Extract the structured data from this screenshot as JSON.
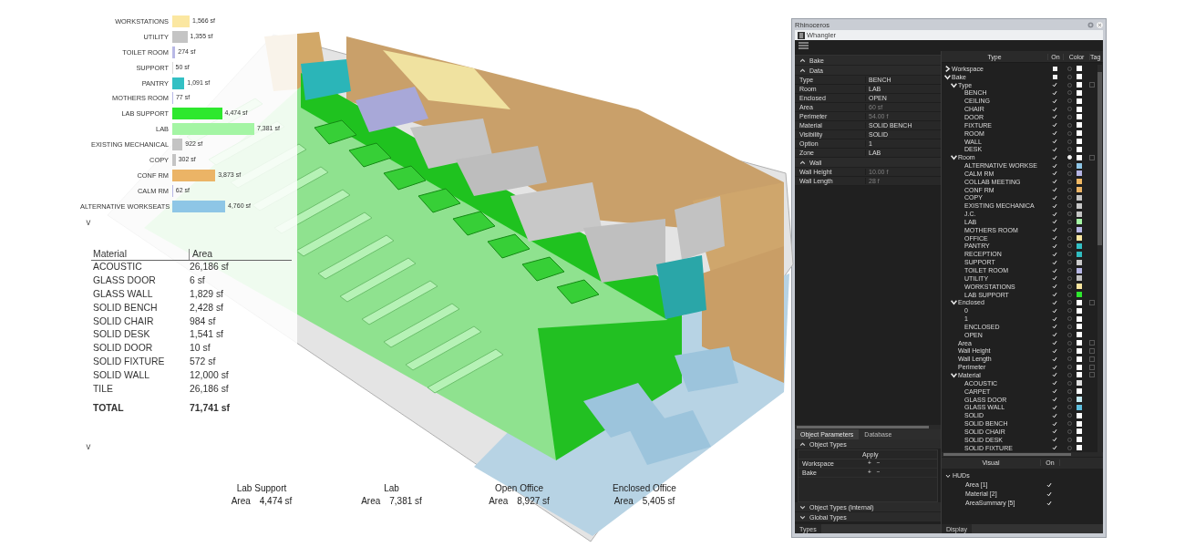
{
  "viewport": {
    "area_legend": [
      {
        "label": "WORKSTATIONS",
        "value": "1,566 sf",
        "color": "#fbe7a1"
      },
      {
        "label": "UTILITY",
        "value": "1,355 sf",
        "color": "#c4c4c4"
      },
      {
        "label": "TOILET ROOM",
        "value": "274 sf",
        "color": "#b8b8e6"
      },
      {
        "label": "SUPPORT",
        "value": "50 sf",
        "color": "#d8d8d8"
      },
      {
        "label": "PANTRY",
        "value": "1,091 sf",
        "color": "#33c0c4"
      },
      {
        "label": "MOTHERS ROOM",
        "value": "77 sf",
        "color": "#b8b8e6"
      },
      {
        "label": "LAB SUPPORT",
        "value": "4,474 sf",
        "color": "#2ee82e"
      },
      {
        "label": "LAB",
        "value": "7,381 sf",
        "color": "#a4f5a4"
      },
      {
        "label": "EXISTING MECHANICAL",
        "value": "922 sf",
        "color": "#c4c4c4"
      },
      {
        "label": "COPY",
        "value": "302 sf",
        "color": "#c4c4c4"
      },
      {
        "label": "CONF RM",
        "value": "3,873 sf",
        "color": "#ebb466"
      },
      {
        "label": "CALM RM",
        "value": "62 sf",
        "color": "#b8b8e6"
      },
      {
        "label": "ALTERNATIVE WORKSEATS",
        "value": "4,760 sf",
        "color": "#8ec6e6"
      }
    ],
    "legend_toggle": "˅",
    "material_table": {
      "columns": [
        "Material",
        "Area"
      ],
      "rows": [
        [
          "ACOUSTIC",
          "26,186 sf"
        ],
        [
          "GLASS DOOR",
          "6 sf"
        ],
        [
          "GLASS WALL",
          "1,829 sf"
        ],
        [
          "SOLID BENCH",
          "2,428 sf"
        ],
        [
          "SOLID CHAIR",
          "984 sf"
        ],
        [
          "SOLID DESK",
          "1,541 sf"
        ],
        [
          "SOLID DOOR",
          "10 sf"
        ],
        [
          "SOLID FIXTURE",
          "572 sf"
        ],
        [
          "SOLID WALL",
          "12,000 sf"
        ],
        [
          "TILE",
          "26,186 sf"
        ]
      ],
      "total": [
        "TOTAL",
        "71,741 sf"
      ]
    },
    "summary_toggle": "˅",
    "zone_summaries": [
      {
        "name": "Lab Support",
        "label": "Area",
        "value": "4,474 sf"
      },
      {
        "name": "Lab",
        "label": "Area",
        "value": "7,381 sf"
      },
      {
        "name": "Open Office",
        "label": "Area",
        "value": "8,927 sf"
      },
      {
        "name": "Enclosed Office",
        "label": "Area",
        "value": "5,405 sf"
      }
    ]
  },
  "window": {
    "title": "Rhinoceros",
    "panel_tab": "Whangler",
    "properties": {
      "title": "Bake",
      "expanded": true,
      "groups": [
        {
          "title": "Data",
          "expanded": true,
          "rows": [
            {
              "name": "Type",
              "value": "BENCH",
              "disabled": false
            },
            {
              "name": "Room",
              "value": "LAB",
              "disabled": false
            },
            {
              "name": "Enclosed",
              "value": "OPEN",
              "disabled": false
            },
            {
              "name": "Area",
              "value": "60 sf",
              "disabled": true
            },
            {
              "name": "Perimeter",
              "value": "54.00 f",
              "disabled": true
            },
            {
              "name": "Material",
              "value": "SOLID BENCH",
              "disabled": false
            },
            {
              "name": "Visibility",
              "value": "SOLID",
              "disabled": false
            },
            {
              "name": "Option",
              "value": "1",
              "disabled": false
            },
            {
              "name": "Zone",
              "value": "LAB",
              "disabled": false
            }
          ]
        },
        {
          "title": "Wall",
          "expanded": true,
          "rows": [
            {
              "name": "Wall Height",
              "value": "10.00 f",
              "disabled": true
            },
            {
              "name": "Wall Length",
              "value": "28 f",
              "disabled": true
            }
          ]
        }
      ]
    },
    "bottom_tabs": [
      {
        "label": "Object Parameters",
        "selected": true
      },
      {
        "label": "Database",
        "selected": false
      }
    ],
    "object_types": {
      "title": "Object Types",
      "expanded": true,
      "column": "Apply",
      "rows": [
        {
          "name": "Workspace",
          "add": "+",
          "remove": "−"
        },
        {
          "name": "Bake",
          "add": "+",
          "remove": "−"
        }
      ]
    },
    "collapsed_sections": [
      {
        "title": "Object Types (Internal)",
        "expanded": false
      },
      {
        "title": "Global Types",
        "expanded": false
      }
    ],
    "left_footer_tab": "Types",
    "type_tree": {
      "columns": [
        "Type",
        "On",
        "Color",
        "Tag"
      ],
      "items": [
        {
          "label": "Workspace",
          "expanded": false,
          "on": false,
          "partial": true,
          "radio": false,
          "color": "#ffffff"
        },
        {
          "label": "Bake",
          "expanded": true,
          "on": false,
          "partial": true,
          "radio": false,
          "color": "#ffffff",
          "children": [
            {
              "label": "Type",
              "expanded": true,
              "on": true,
              "partial": false,
              "radio": false,
              "color": "#ffffff",
              "tag": false,
              "children": [
                {
                  "label": "BENCH",
                  "on": true,
                  "partial": false,
                  "radio": false,
                  "color": "#ffffff"
                },
                {
                  "label": "CEILING",
                  "on": true,
                  "partial": false,
                  "radio": false,
                  "color": "#ffffff"
                },
                {
                  "label": "CHAIR",
                  "on": true,
                  "partial": false,
                  "radio": false,
                  "color": "#ffffff"
                },
                {
                  "label": "DOOR",
                  "on": true,
                  "partial": false,
                  "radio": false,
                  "color": "#ffffff"
                },
                {
                  "label": "FIXTURE",
                  "on": true,
                  "partial": false,
                  "radio": false,
                  "color": "#ffffff"
                },
                {
                  "label": "ROOM",
                  "on": true,
                  "partial": false,
                  "radio": false,
                  "color": "#ffffff"
                },
                {
                  "label": "WALL",
                  "on": true,
                  "partial": false,
                  "radio": false,
                  "color": "#ffffff"
                },
                {
                  "label": "DESK",
                  "on": true,
                  "partial": false,
                  "radio": false,
                  "color": "#ffffff"
                }
              ]
            },
            {
              "label": "Room",
              "expanded": true,
              "on": true,
              "partial": false,
              "radio": true,
              "color": "#ffffff",
              "tag": false,
              "children": [
                {
                  "label": "ALTERNATIVE WORKSE",
                  "on": true,
                  "partial": false,
                  "radio": false,
                  "color": "#8ec6e6"
                },
                {
                  "label": "CALM RM",
                  "on": true,
                  "partial": false,
                  "radio": false,
                  "color": "#b4b4e4"
                },
                {
                  "label": "COLLAB MEETING",
                  "on": true,
                  "partial": false,
                  "radio": false,
                  "color": "#f0b864"
                },
                {
                  "label": "CONF RM",
                  "on": true,
                  "partial": false,
                  "radio": false,
                  "color": "#ebb466"
                },
                {
                  "label": "COPY",
                  "on": true,
                  "partial": false,
                  "radio": false,
                  "color": "#c4c4c4"
                },
                {
                  "label": "EXISTING MECHANICA",
                  "on": true,
                  "partial": false,
                  "radio": false,
                  "color": "#c8c8c8"
                },
                {
                  "label": "J.C.",
                  "on": true,
                  "partial": false,
                  "radio": false,
                  "color": "#c6c6c6"
                },
                {
                  "label": "LAB",
                  "on": true,
                  "partial": false,
                  "radio": false,
                  "color": "#a4f5a4"
                },
                {
                  "label": "MOTHERS ROOM",
                  "on": true,
                  "partial": false,
                  "radio": false,
                  "color": "#b8b8e6"
                },
                {
                  "label": "OFFICE",
                  "on": true,
                  "partial": false,
                  "radio": false,
                  "color": "#fbe7a1"
                },
                {
                  "label": "PANTRY",
                  "on": true,
                  "partial": false,
                  "radio": false,
                  "color": "#33c0c4"
                },
                {
                  "label": "RECEPTION",
                  "on": true,
                  "partial": false,
                  "radio": false,
                  "color": "#30bcc0"
                },
                {
                  "label": "SUPPORT",
                  "on": true,
                  "partial": false,
                  "radio": false,
                  "color": "#cacaca"
                },
                {
                  "label": "TOILET ROOM",
                  "on": true,
                  "partial": false,
                  "radio": false,
                  "color": "#b6b6e4"
                },
                {
                  "label": "UTILITY",
                  "on": true,
                  "partial": false,
                  "radio": false,
                  "color": "#c2c2c2"
                },
                {
                  "label": "WORKSTATIONS",
                  "on": true,
                  "partial": false,
                  "radio": false,
                  "color": "#f9e59f"
                },
                {
                  "label": "LAB SUPPORT",
                  "on": true,
                  "partial": false,
                  "radio": false,
                  "color": "#2ee82e"
                }
              ]
            },
            {
              "label": "Enclosed",
              "expanded": true,
              "on": true,
              "partial": false,
              "radio": false,
              "color": "#ffffff",
              "tag": false,
              "children": [
                {
                  "label": "0",
                  "on": true,
                  "partial": false,
                  "radio": false,
                  "color": "#ffffff"
                },
                {
                  "label": "1",
                  "on": true,
                  "partial": false,
                  "radio": false,
                  "color": "#ffffff"
                },
                {
                  "label": "ENCLOSED",
                  "on": true,
                  "partial": false,
                  "radio": false,
                  "color": "#ffffff"
                },
                {
                  "label": "OPEN",
                  "on": true,
                  "partial": false,
                  "radio": false,
                  "color": "#ffffff"
                }
              ]
            },
            {
              "label": "Area",
              "on": true,
              "partial": false,
              "radio": false,
              "color": "#ffffff",
              "tag": false
            },
            {
              "label": "Wall Height",
              "on": true,
              "partial": false,
              "radio": false,
              "color": "#ffffff",
              "tag": false
            },
            {
              "label": "Wall Length",
              "on": true,
              "partial": false,
              "radio": false,
              "color": "#ffffff",
              "tag": false
            },
            {
              "label": "Perimeter",
              "on": true,
              "partial": false,
              "radio": false,
              "color": "#ffffff",
              "tag": false
            },
            {
              "label": "Material",
              "expanded": true,
              "on": true,
              "partial": false,
              "radio": false,
              "color": "#ffffff",
              "tag": false,
              "children": [
                {
                  "label": "ACOUSTIC",
                  "on": true,
                  "partial": false,
                  "radio": false,
                  "color": "#e0e0e0"
                },
                {
                  "label": "CARPET",
                  "on": true,
                  "partial": false,
                  "radio": false,
                  "color": "#ffffff"
                },
                {
                  "label": "GLASS DOOR",
                  "on": true,
                  "partial": false,
                  "radio": false,
                  "color": "#c4eaf2"
                },
                {
                  "label": "GLASS WALL",
                  "on": true,
                  "partial": false,
                  "radio": false,
                  "color": "#5ec0e0"
                },
                {
                  "label": "SOLID",
                  "on": true,
                  "partial": false,
                  "radio": false,
                  "color": "#fefefe"
                },
                {
                  "label": "SOLID BENCH",
                  "on": true,
                  "partial": false,
                  "radio": false,
                  "color": "#fdfdfd"
                },
                {
                  "label": "SOLID CHAIR",
                  "on": true,
                  "partial": false,
                  "radio": false,
                  "color": "#fcfcfc"
                },
                {
                  "label": "SOLID DESK",
                  "on": true,
                  "partial": false,
                  "radio": false,
                  "color": "#fbfbfb"
                },
                {
                  "label": "SOLID FIXTURE",
                  "on": true,
                  "partial": false,
                  "radio": false,
                  "color": "#fafafa"
                }
              ]
            }
          ]
        }
      ]
    },
    "visual": {
      "columns": [
        "Visual",
        "On"
      ],
      "items": [
        {
          "label": "HUDs",
          "expanded": true,
          "children": [
            {
              "label": "Area [1]",
              "on": true
            },
            {
              "label": "Material [2]",
              "on": true
            },
            {
              "label": "AreaSummary [5]",
              "on": true
            }
          ]
        }
      ]
    },
    "right_footer_tab": "Display"
  }
}
